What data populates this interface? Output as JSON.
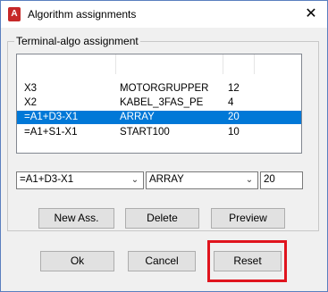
{
  "window": {
    "title": "Algorithm assignments",
    "close_glyph": "✕",
    "app_icon_letter": "A"
  },
  "group": {
    "label": "Terminal-algo assignment"
  },
  "list": {
    "rows": [
      {
        "terminal": "X3",
        "algo": "MOTORGRUPPER",
        "value": "12",
        "selected": false
      },
      {
        "terminal": "X2",
        "algo": "KABEL_3FAS_PE",
        "value": "4",
        "selected": false
      },
      {
        "terminal": "=A1+D3-X1",
        "algo": "ARRAY",
        "value": "20",
        "selected": true
      },
      {
        "terminal": "=A1+S1-X1",
        "algo": "START100",
        "value": "10",
        "selected": false
      }
    ]
  },
  "editors": {
    "terminal_value": "=A1+D3-X1",
    "algo_value": "ARRAY",
    "number_value": "20",
    "dropdown_glyph": "⌄"
  },
  "buttons": {
    "new_ass": "New Ass.",
    "delete": "Delete",
    "preview": "Preview",
    "ok": "Ok",
    "cancel": "Cancel",
    "reset": "Reset"
  },
  "colors": {
    "selection": "#0078d7",
    "highlight_box": "#e0141e",
    "app_icon": "#c62828"
  }
}
